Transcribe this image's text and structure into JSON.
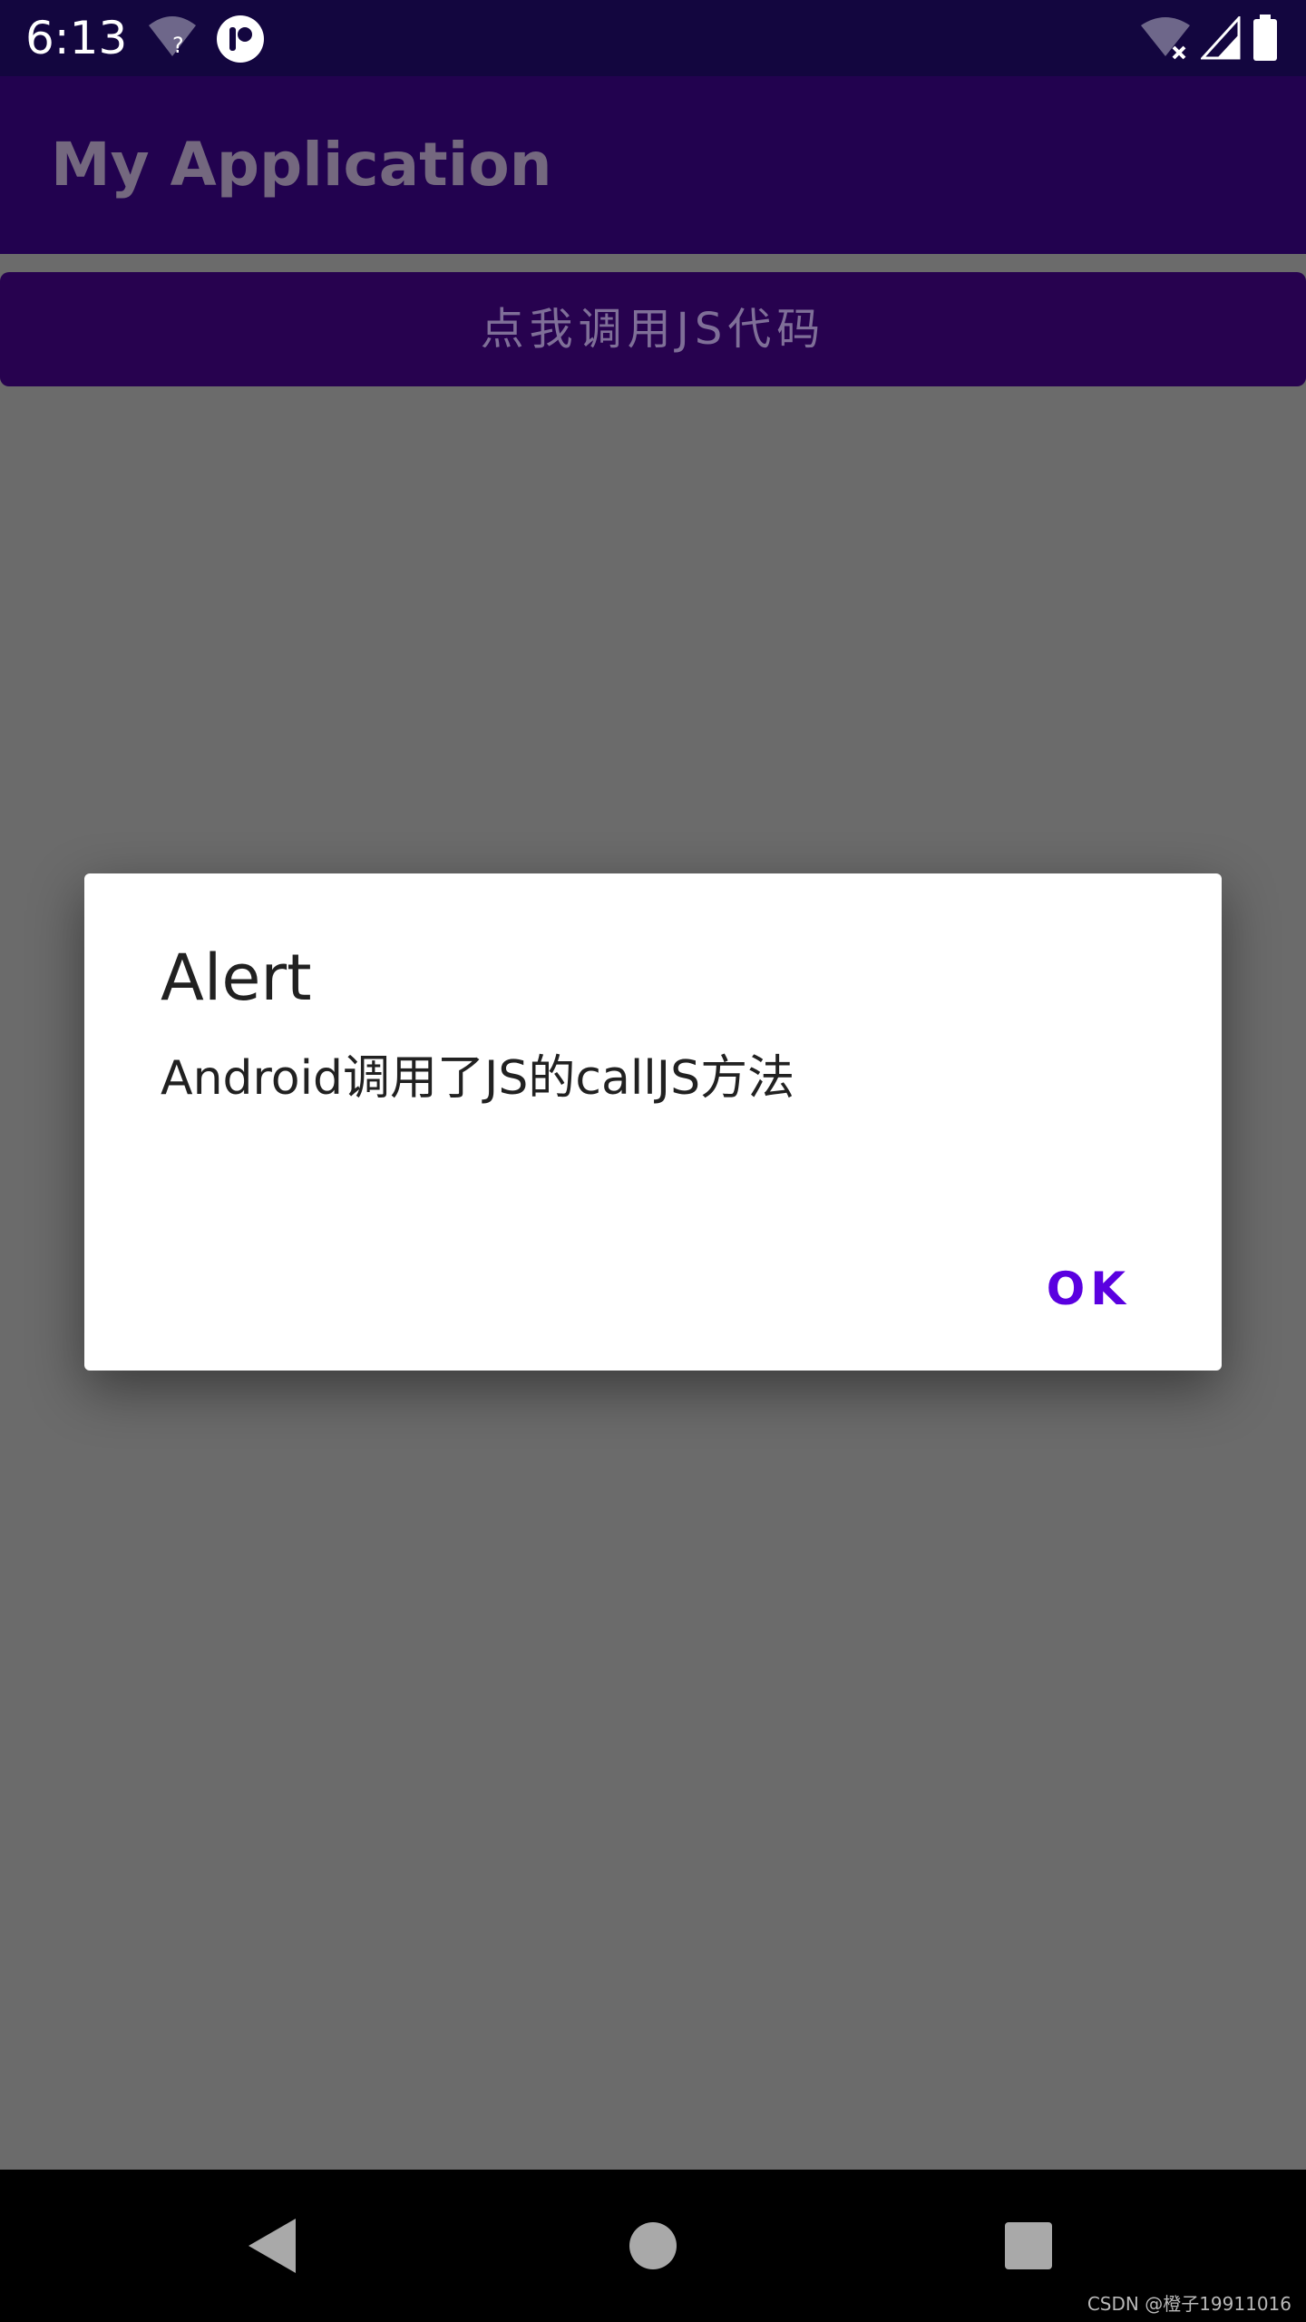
{
  "status_bar": {
    "time": "6:13",
    "left_icons": [
      "wifi-question-icon",
      "app-notification-icon"
    ],
    "right_icons": [
      "wifi-off-icon",
      "cell-signal-icon",
      "battery-icon"
    ]
  },
  "app_bar": {
    "title": "My Application"
  },
  "main": {
    "call_js_button_label": "点我调用JS代码"
  },
  "dialog": {
    "title": "Alert",
    "message": "Android调用了JS的callJS方法",
    "ok_label": "OK"
  },
  "nav_bar": {
    "buttons": [
      "back-icon",
      "home-icon",
      "recents-icon"
    ]
  },
  "watermark": "CSDN @橙子19911016",
  "colors": {
    "status_bar": "#13063f",
    "app_bar": "#22024f",
    "button": "#27024f",
    "scrim": "#6b6b6b",
    "accent": "#5a00e0",
    "dialog_bg": "#ffffff",
    "nav_bar": "#000000"
  }
}
